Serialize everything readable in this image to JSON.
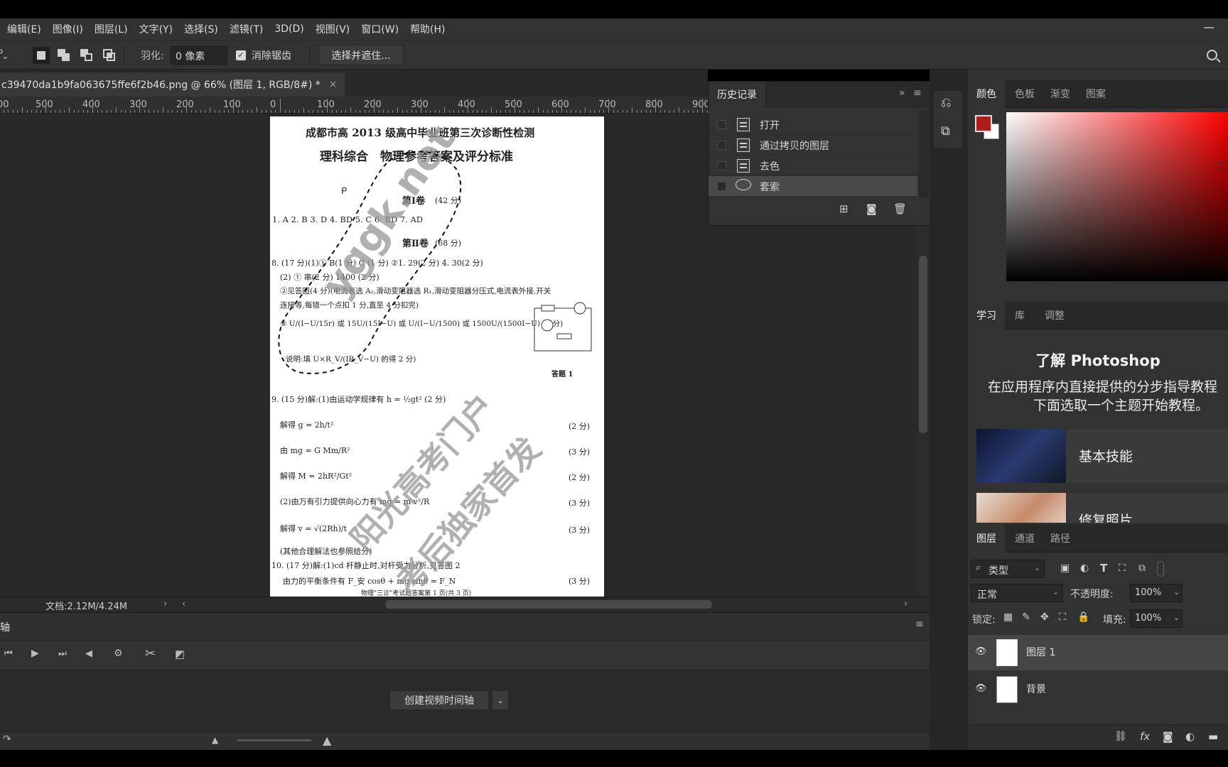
{
  "menu": {
    "items": [
      "编辑(E)",
      "图像(I)",
      "图层(L)",
      "文字(Y)",
      "选择(S)",
      "滤镜(T)",
      "3D(D)",
      "视图(V)",
      "窗口(W)",
      "帮助(H)"
    ]
  },
  "options": {
    "feather_label": "羽化:",
    "feather_value": "0 像素",
    "antialias_label": "消除锯齿",
    "select_mask_label": "选择并遮住..."
  },
  "document": {
    "tab_title": "c39470da1b9fa063675ffe6f2b46.png @ 66% (图层 1, RGB/8#) *",
    "ruler_numbers": [
      "00",
      "500",
      "400",
      "300",
      "200",
      "100",
      "0",
      "100",
      "200",
      "300",
      "400",
      "500",
      "600",
      "700",
      "800",
      "900"
    ],
    "status_text": "文档:2.12M/4.24M"
  },
  "page": {
    "title": "成都市高 2013 级高中毕业班第三次诊断性检测",
    "subtitle": "理科综合　物理参考答案及评分标准",
    "section1": "第Ⅰ卷",
    "section1_score": "(42 分)",
    "answers1": "1.  A      2. B      3. D      4. BD      5. C      6. BD      7. AD",
    "section2": "第Ⅱ卷",
    "section2_score": "(68 分)",
    "q8_line1": "8. (17 分)(1)① B(1 分) C (1 分)   ②1. 29(2 分) 4. 30(2 分)",
    "q8_line2": "(2) ① 串(2 分) 1400 (2 分)",
    "q8_line3": "②见答图(4 分)(电流表选 A₂,滑动变阻器选 R₁,滑动变阻器分压式,电流表外接,开关",
    "q8_line4": "连接等,每错一个点扣 1 分,直至 4 分扣完)",
    "q8_line5": "③  U/(I−U/15r)  或  15U/(15I−U)  或  U/(I−U/1500)  或  1500U/(1500I−U)   (3 分)",
    "q8_line6": "说明:填 U×R_V/(IR_V−U) 的得 2 分)",
    "figure_label": "答题 1",
    "q9_line1": "9. (15 分)解:(1)由运动学规律有 h = ½gt²          (2 分)",
    "q9_line2": "解得 g = 2h/t²",
    "q9_line3": "由 mg = G Mm/R²",
    "q9_line4": "解得 M = 2hR²/Gt²",
    "q9_line5": "(2)由万有引力提供向心力有 mg = m v²/R",
    "q9_line6": "解得 v = √(2Rh)/t",
    "q9_line7": "(其他合理解法也参照给分)",
    "q10_line1": "10. (17 分)解:(1)cd 杆静止时,对杆受力分析,见答图 2",
    "q10_line2": "由力的平衡条件有 F_安 cosθ + mg sinθ = F_N",
    "scores": [
      "(2 分)",
      "(3 分)",
      "(2 分)",
      "(3 分)",
      "(3 分)",
      "(3 分)"
    ],
    "footer": "物理\"三诊\"考试题答案第 1 页(共 3 页)",
    "watermark_url": "yggk.net",
    "watermark_line1": "阳光高考门户",
    "watermark_line2": "考后独家首发"
  },
  "history": {
    "tab": "历史记录",
    "items": [
      "打开",
      "通过拷贝的图层",
      "去色",
      "套索"
    ]
  },
  "timeline": {
    "tab": "轴",
    "create_button": "创建视频时间轴"
  },
  "color_panel": {
    "tabs": [
      "颜色",
      "色板",
      "渐变",
      "图案"
    ],
    "foreground": "#b01c1c",
    "background": "#ffffff"
  },
  "learn_panel": {
    "tabs": [
      "学习",
      "库",
      "调整"
    ],
    "heading": "了解 Photoshop",
    "desc_line1": "在应用程序内直接提供的分步指导教程",
    "desc_line2": "下面选取一个主题开始教程。",
    "cards": [
      "基本技能",
      "修复照片"
    ]
  },
  "layers_panel": {
    "tabs": [
      "图层",
      "通道",
      "路径"
    ],
    "filter_label": "类型",
    "blend_mode": "正常",
    "opacity_label": "不透明度:",
    "opacity_value": "100%",
    "lock_label": "锁定:",
    "fill_label": "填充:",
    "fill_value": "100%",
    "layers": [
      "图层 1",
      "背景"
    ]
  }
}
